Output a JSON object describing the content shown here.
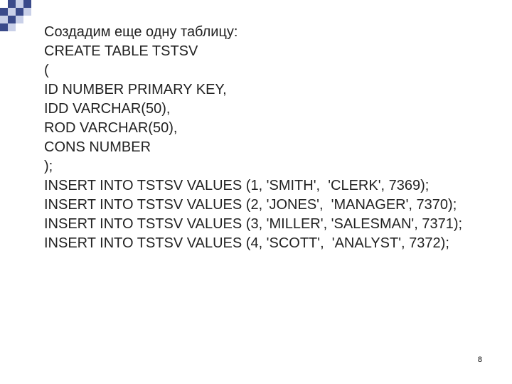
{
  "decor": {
    "dark": "#3a4a8a",
    "light": "#c9d0e8"
  },
  "lines": [
    "Создадим еще одну таблицу:",
    "CREATE TABLE TSTSV",
    "(",
    "ID NUMBER PRIMARY KEY,",
    "IDD VARCHAR(50),",
    "ROD VARCHAR(50),",
    "CONS NUMBER",
    ");",
    "INSERT INTO TSTSV VALUES (1, 'SMITH',  'CLERK', 7369);",
    "INSERT INTO TSTSV VALUES (2, 'JONES',  'MANAGER', 7370);",
    "INSERT INTO TSTSV VALUES (3, 'MILLER', 'SALESMAN', 7371);",
    "INSERT INTO TSTSV VALUES (4, 'SCOTT',  'ANALYST', 7372);"
  ],
  "page_number": "8"
}
